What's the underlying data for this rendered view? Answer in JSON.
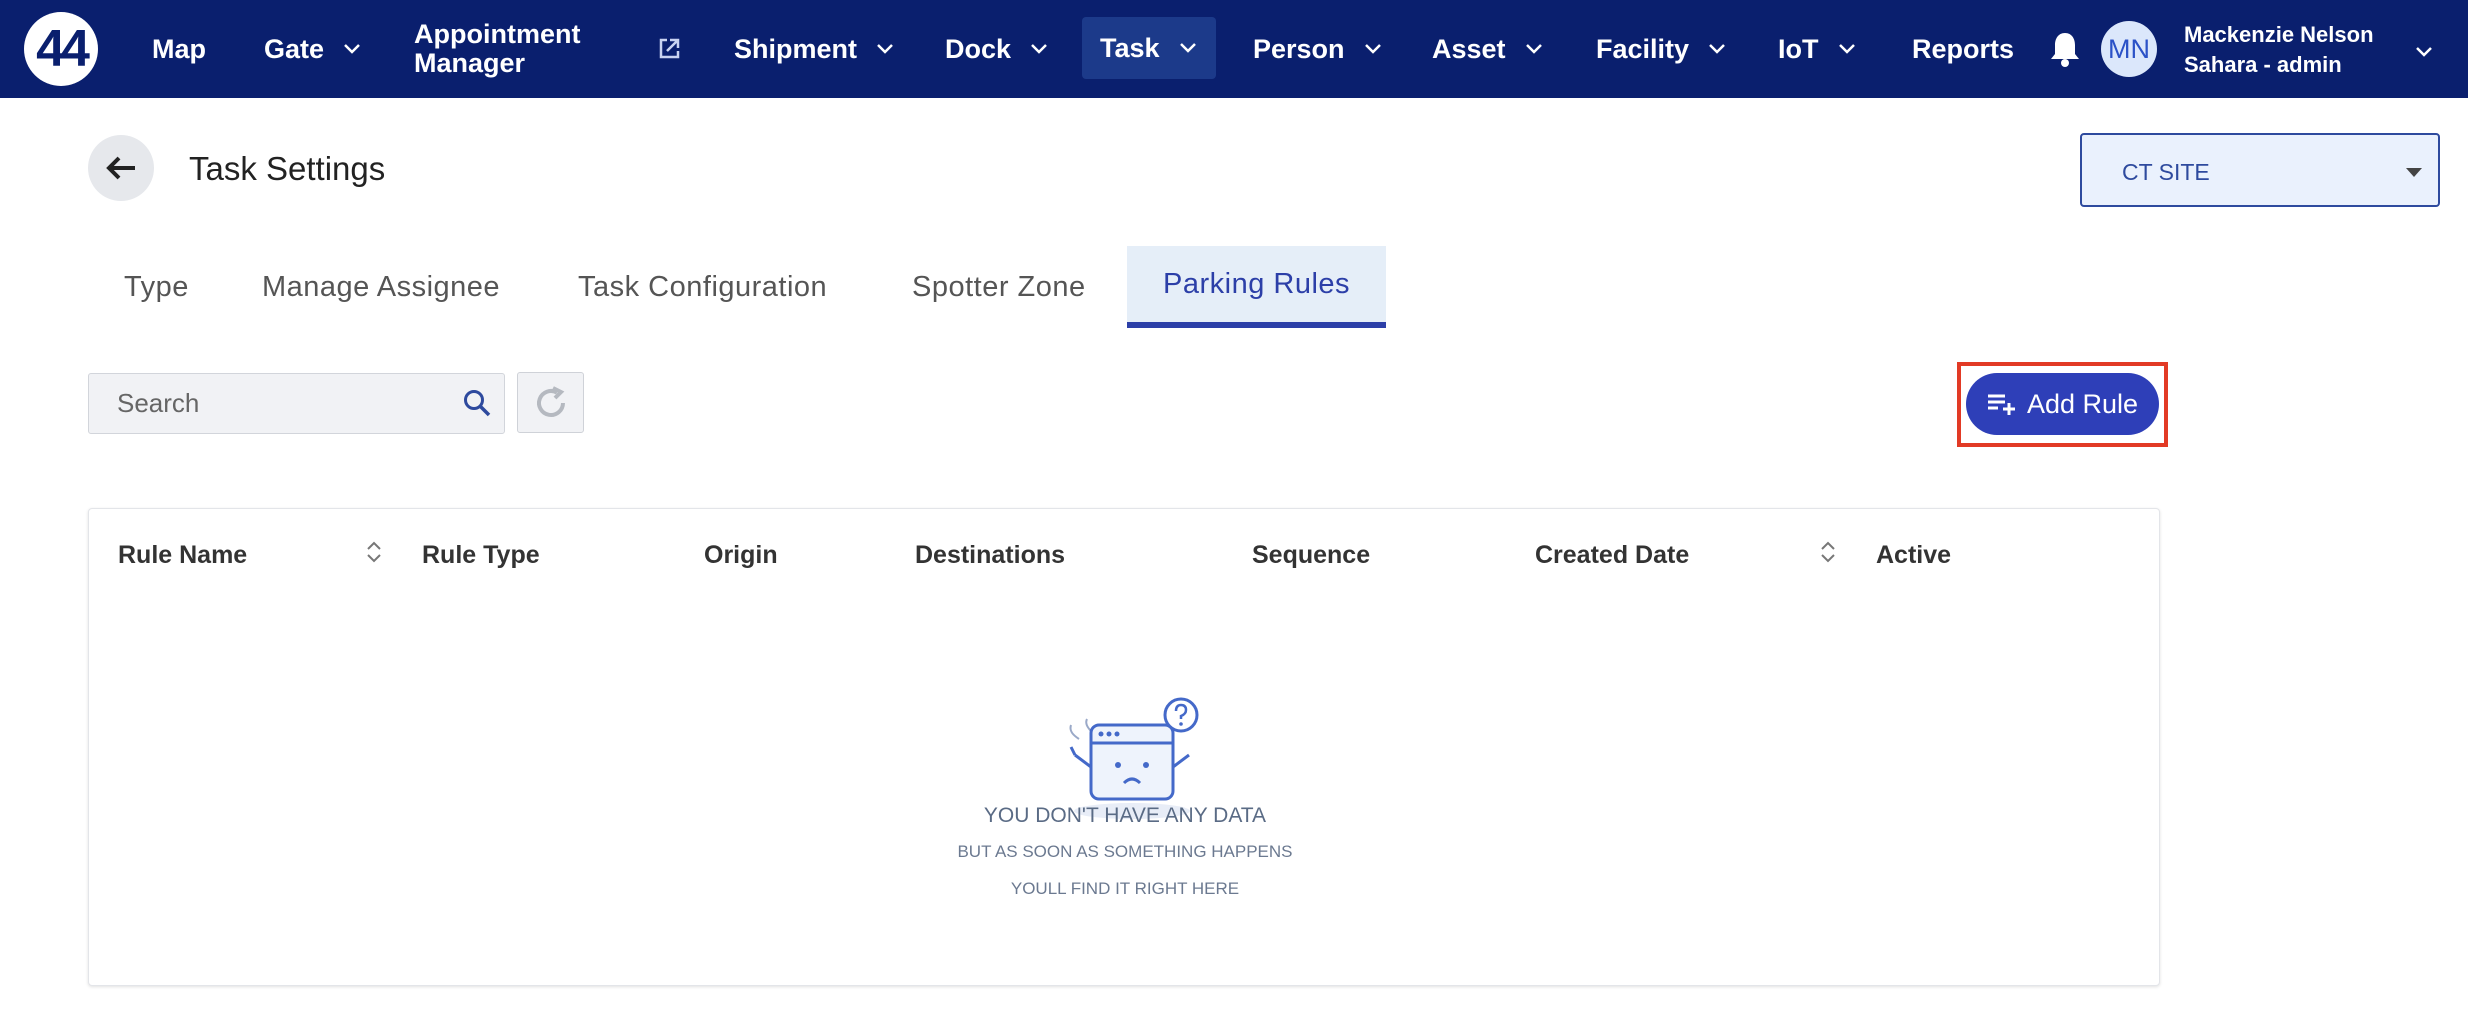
{
  "nav": {
    "logo": "44",
    "items": [
      {
        "label": "Map",
        "dropdown": false
      },
      {
        "label": "Gate",
        "dropdown": true
      },
      {
        "label_line1": "Appointment",
        "label_line2": "Manager",
        "external": true
      },
      {
        "label": "Shipment",
        "dropdown": true
      },
      {
        "label": "Dock",
        "dropdown": true
      },
      {
        "label": "Task",
        "dropdown": true,
        "active": true
      },
      {
        "label": "Person",
        "dropdown": true
      },
      {
        "label": "Asset",
        "dropdown": true
      },
      {
        "label": "Facility",
        "dropdown": true
      },
      {
        "label": "IoT",
        "dropdown": true
      },
      {
        "label": "Reports",
        "dropdown": false
      }
    ],
    "user": {
      "initials": "MN",
      "name": "Mackenzie Nelson",
      "role": "Sahara - admin"
    }
  },
  "header": {
    "title": "Task Settings",
    "site_select": {
      "value": "CT SITE"
    }
  },
  "tabs": [
    {
      "label": "Type"
    },
    {
      "label": "Manage Assignee"
    },
    {
      "label": "Task Configuration"
    },
    {
      "label": "Spotter Zone"
    },
    {
      "label": "Parking Rules",
      "active": true
    }
  ],
  "toolbar": {
    "search_placeholder": "Search",
    "add_rule_label": "Add Rule"
  },
  "table": {
    "columns": [
      {
        "label": "Rule Name",
        "sortable": true
      },
      {
        "label": "Rule Type",
        "sortable": false
      },
      {
        "label": "Origin",
        "sortable": false
      },
      {
        "label": "Destinations",
        "sortable": false
      },
      {
        "label": "Sequence",
        "sortable": false
      },
      {
        "label": "Created Date",
        "sortable": true
      },
      {
        "label": "Active",
        "sortable": false
      }
    ],
    "rows": [],
    "empty": {
      "title": "YOU DON'T HAVE ANY DATA",
      "line1": "BUT AS SOON AS SOMETHING HAPPENS",
      "line2": "YOULL FIND IT RIGHT HERE"
    }
  },
  "colors": {
    "nav_bg": "#0a1f6e",
    "accent": "#2e3fb8",
    "highlight": "#e23a25"
  }
}
